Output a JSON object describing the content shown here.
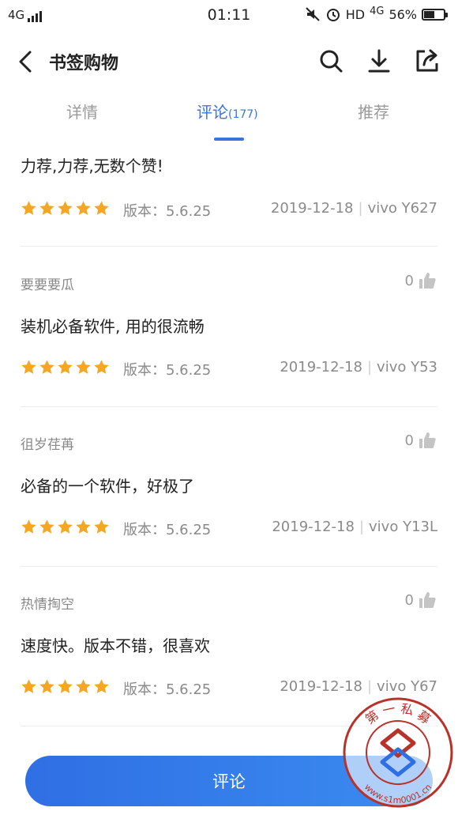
{
  "status_bar": {
    "network_left": "4G",
    "time": "01:11",
    "hd": "HD",
    "network_right": "4G",
    "battery": "56%",
    "battery_level": 0.56
  },
  "header": {
    "title": "书签购物"
  },
  "tabs": [
    {
      "label": "详情",
      "count": ""
    },
    {
      "label": "评论",
      "count": "(177)"
    },
    {
      "label": "推荐",
      "count": ""
    }
  ],
  "reviews": [
    {
      "user": "",
      "likes": "",
      "text": "力荐,力荐,无数个赞!",
      "rating": 5,
      "version": "版本：5.6.25",
      "date": "2019-12-18",
      "device": "vivo Y627"
    },
    {
      "user": "要要要瓜",
      "likes": "0",
      "text": "装机必备软件, 用的很流畅",
      "rating": 5,
      "version": "版本：5.6.25",
      "date": "2019-12-18",
      "device": "vivo Y53"
    },
    {
      "user": "徂岁荏苒",
      "likes": "0",
      "text": "必备的一个软件，好极了",
      "rating": 5,
      "version": "版本：5.6.25",
      "date": "2019-12-18",
      "device": "vivo Y13L"
    },
    {
      "user": "热情掏空",
      "likes": "0",
      "text": "速度快。版本不错，很喜欢",
      "rating": 5,
      "version": "版本：5.6.25",
      "date": "2019-12-18",
      "device": "vivo Y67"
    }
  ],
  "bottom_bar": {
    "comment_label": "评论"
  },
  "watermark": {
    "text_top": "第 一 私 募",
    "text_bottom": "www.s1m0001.cn"
  },
  "colors": {
    "accent": "#3b73e0",
    "star": "#f5a623"
  },
  "icons": [
    "back-arrow-icon",
    "search-icon",
    "download-icon",
    "share-icon",
    "thumbs-up-icon",
    "star-icon"
  ]
}
